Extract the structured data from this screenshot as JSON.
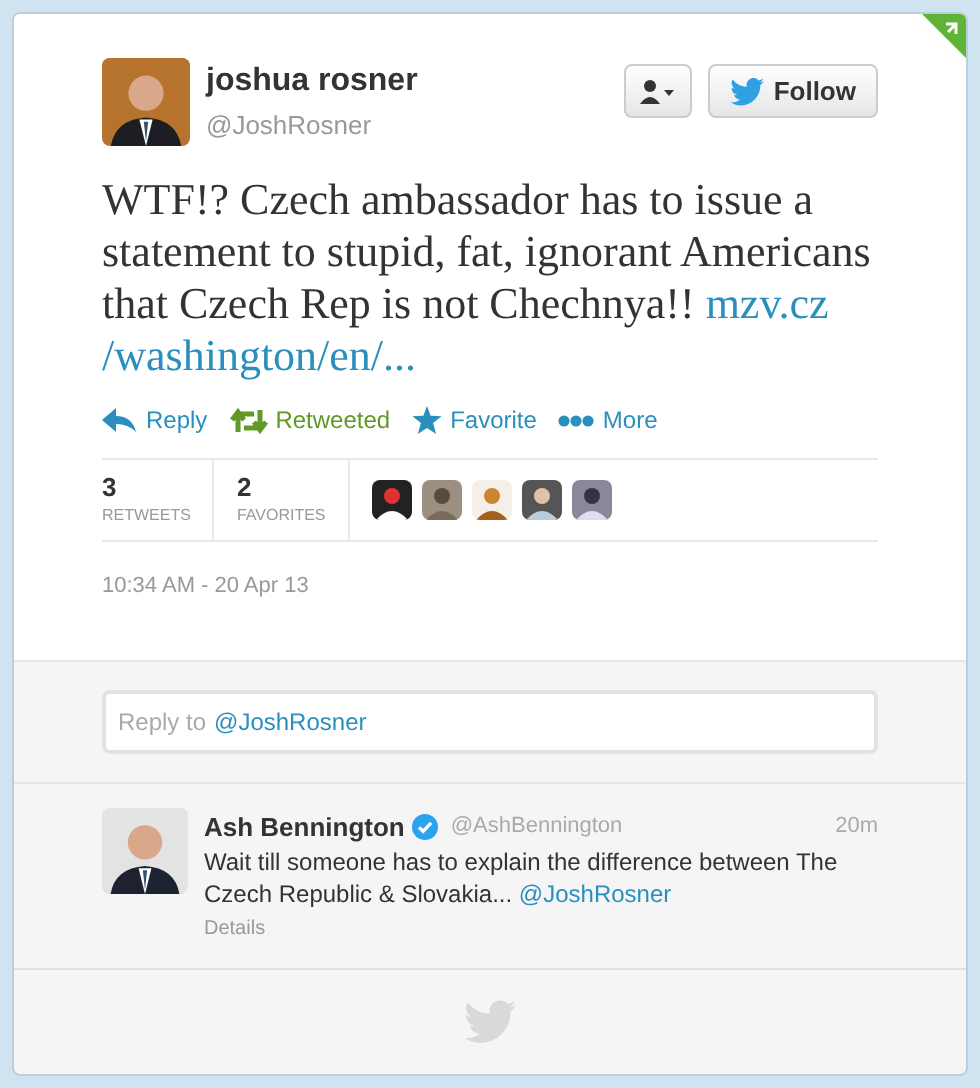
{
  "author": {
    "name": "joshua rosner",
    "handle": "@JoshRosner"
  },
  "follow_button": {
    "label": "Follow"
  },
  "tweet": {
    "text": "WTF!? Czech ambassador has to issue a statement to stupid, fat, ignorant Americans that Czech Rep is not Chechnya!!",
    "link_parts": [
      "mzv.cz",
      "/washington/en/..."
    ]
  },
  "actions": [
    {
      "kind": "reply",
      "label": "Reply",
      "active": false
    },
    {
      "kind": "retweet",
      "label": "Retweeted",
      "active": true
    },
    {
      "kind": "favorite",
      "label": "Favorite",
      "active": false
    },
    {
      "kind": "more",
      "label": "More",
      "active": false
    }
  ],
  "stats": [
    {
      "count": "3",
      "label": "RETWEETS"
    },
    {
      "count": "2",
      "label": "FAVORITES"
    }
  ],
  "timestamp": "10:34 AM - 20 Apr 13",
  "reply_box": {
    "placeholder_prefix": "Reply to",
    "mention": "@JoshRosner"
  },
  "replies": [
    {
      "name": "Ash Bennington",
      "verified": true,
      "handle": "@AshBennington",
      "time": "20m",
      "text": "Wait till someone has to explain the difference between The Czech Republic & Slovakia...",
      "mention": "@JoshRosner",
      "details": "Details"
    }
  ]
}
